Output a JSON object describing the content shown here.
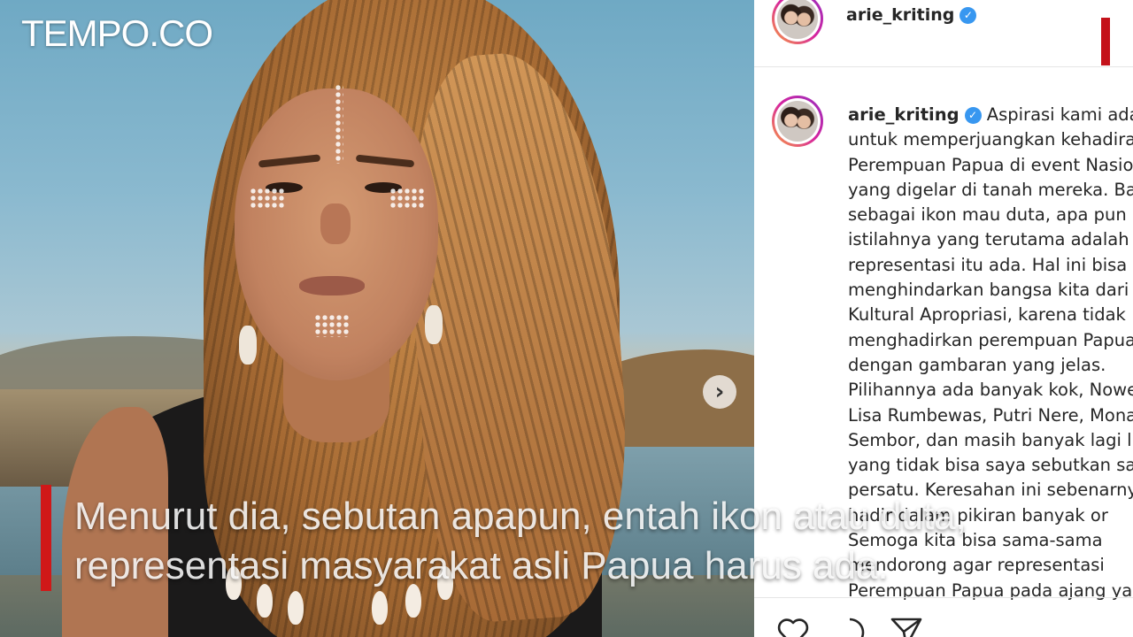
{
  "logo": {
    "text": "TEMPO.CO"
  },
  "instagram": {
    "header": {
      "username": "arie_kriting",
      "verified_icon": "verified-badge-icon"
    },
    "post": {
      "username": "arie_kriting",
      "caption_lines": [
        "Aspirasi kami adal",
        "untuk memperjuangkan kehadira",
        "Perempuan Papua di event Nasio",
        "yang digelar di tanah mereka. Ba",
        "sebagai ikon mau duta, apa pun",
        "istilahnya yang terutama adalah",
        "representasi itu ada. Hal ini bisa",
        "menghindarkan bangsa kita dari",
        "Kultural Apropriasi, karena tidak",
        "menghadirkan perempuan Papua",
        "dengan gambaran yang jelas.",
        "Pilihannya ada banyak kok, Nowe",
        "Lisa Rumbewas, Putri Nere, Mona",
        "Sembor, dan masih banyak lagi l",
        "yang tidak bisa saya sebutkan sa",
        "persatu. Keresahan ini sebenarny",
        "hadir dalam pikiran banyak or",
        "Semoga kita bisa sama-sama",
        "mendorong agar representasi",
        "Perempuan Papua pada ajang ya"
      ]
    },
    "actions": [
      "heart-icon",
      "comment-icon",
      "share-icon"
    ]
  },
  "photo": {
    "carousel_next": "›"
  },
  "subtitle": {
    "line1": "Menurut dia, sebutan apapun, entah ikon atau duta,",
    "line2": "representasi masyarakat asli Papua harus ada."
  },
  "colors": {
    "accent_red": "#d01818",
    "verified_blue": "#3897f0"
  }
}
